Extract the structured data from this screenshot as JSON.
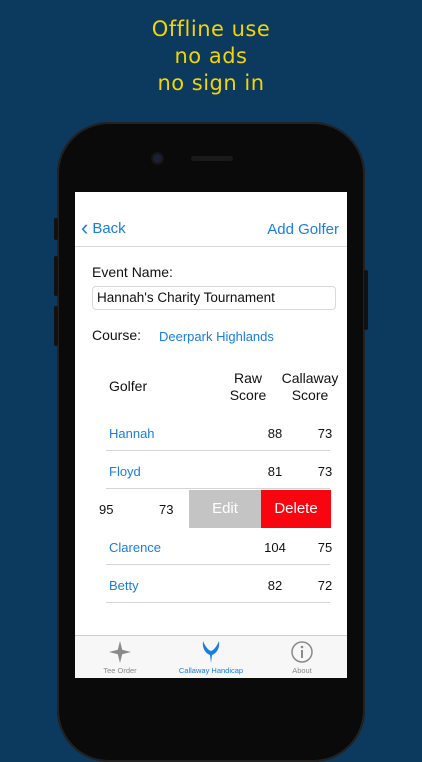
{
  "promo": {
    "line1": "Offline use",
    "line2": "no ads",
    "line3": "no sign in"
  },
  "nav": {
    "back_label": "Back",
    "add_label": "Add Golfer"
  },
  "event": {
    "label": "Event Name:",
    "value": "Hannah's Charity Tournament"
  },
  "course": {
    "label": "Course:",
    "value": "Deerpark Highlands"
  },
  "table": {
    "headers": {
      "golfer": "Golfer",
      "raw1": "Raw",
      "raw2": "Score",
      "cal1": "Callaway",
      "cal2": "Score"
    },
    "rows": [
      {
        "name": "Hannah",
        "raw": "88",
        "cal": "73"
      },
      {
        "name": "Floyd",
        "raw": "81",
        "cal": "73"
      },
      {
        "name": "Clarence",
        "raw": "104",
        "cal": "75"
      },
      {
        "name": "Betty",
        "raw": "82",
        "cal": "72"
      }
    ],
    "swiped_row": {
      "raw": "95",
      "cal": "73",
      "edit_label": "Edit",
      "delete_label": "Delete"
    }
  },
  "tabs": [
    {
      "label": "Tee Order",
      "icon": "star-icon"
    },
    {
      "label": "Callaway Handicap",
      "icon": "callaway-logo-icon"
    },
    {
      "label": "About",
      "icon": "info-icon"
    }
  ],
  "colors": {
    "background": "#0b3a5e",
    "promo": "#f5d400",
    "accent": "#1a7ee0",
    "delete": "#f90510",
    "edit": "#c4c4c4"
  }
}
